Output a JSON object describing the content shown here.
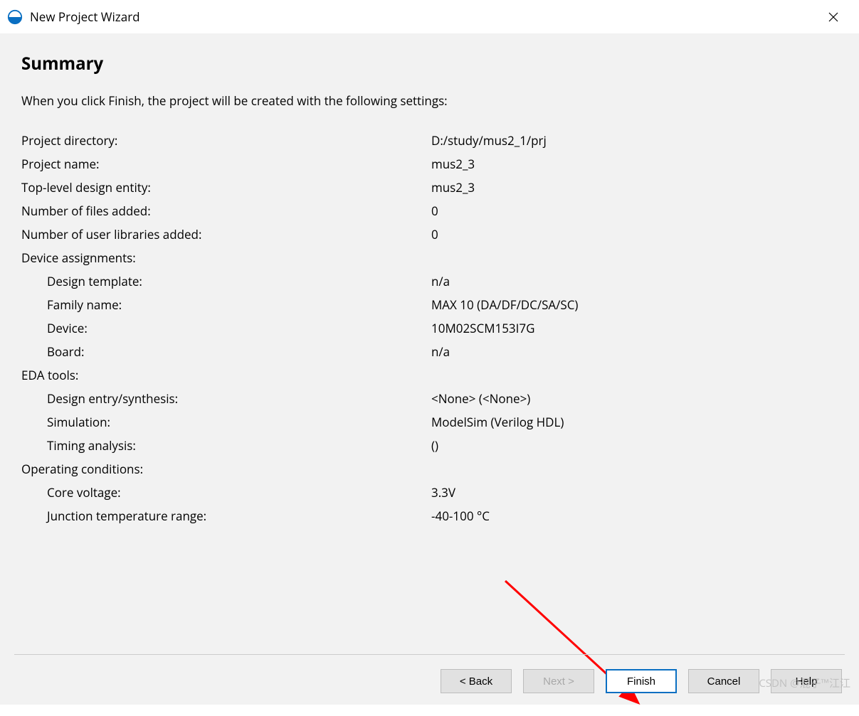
{
  "window": {
    "title": "New Project Wizard"
  },
  "heading": "Summary",
  "intro": "When you click Finish, the project will be created with the following settings:",
  "rows": [
    {
      "label": "Project directory:",
      "value": "D:/study/mus2_1/prj",
      "indent": 0
    },
    {
      "label": "Project name:",
      "value": "mus2_3",
      "indent": 0
    },
    {
      "label": "Top-level design entity:",
      "value": "mus2_3",
      "indent": 0
    },
    {
      "label": "Number of files added:",
      "value": "0",
      "indent": 0
    },
    {
      "label": "Number of user libraries added:",
      "value": "0",
      "indent": 0
    },
    {
      "label": "Device assignments:",
      "value": "",
      "indent": 0
    },
    {
      "label": "Design template:",
      "value": "n/a",
      "indent": 1
    },
    {
      "label": "Family name:",
      "value": "MAX 10 (DA/DF/DC/SA/SC)",
      "indent": 1
    },
    {
      "label": "Device:",
      "value": "10M02SCM153I7G",
      "indent": 1
    },
    {
      "label": "Board:",
      "value": "n/a",
      "indent": 1
    },
    {
      "label": "EDA tools:",
      "value": "",
      "indent": 0
    },
    {
      "label": "Design entry/synthesis:",
      "value": "<None> (<None>)",
      "indent": 1
    },
    {
      "label": "Simulation:",
      "value": "ModelSim (Verilog HDL)",
      "indent": 1
    },
    {
      "label": "Timing analysis:",
      "value": "()",
      "indent": 1
    },
    {
      "label": "Operating conditions:",
      "value": "",
      "indent": 0
    },
    {
      "label": "Core voltage:",
      "value": "3.3V",
      "indent": 1
    },
    {
      "label": "Junction temperature range:",
      "value": "-40-100 °C",
      "indent": 1
    }
  ],
  "buttons": {
    "back": "< Back",
    "next": "Next >",
    "finish": "Finish",
    "cancel": "Cancel",
    "help": "Help"
  },
  "watermark": "CSDN @混子™江江"
}
